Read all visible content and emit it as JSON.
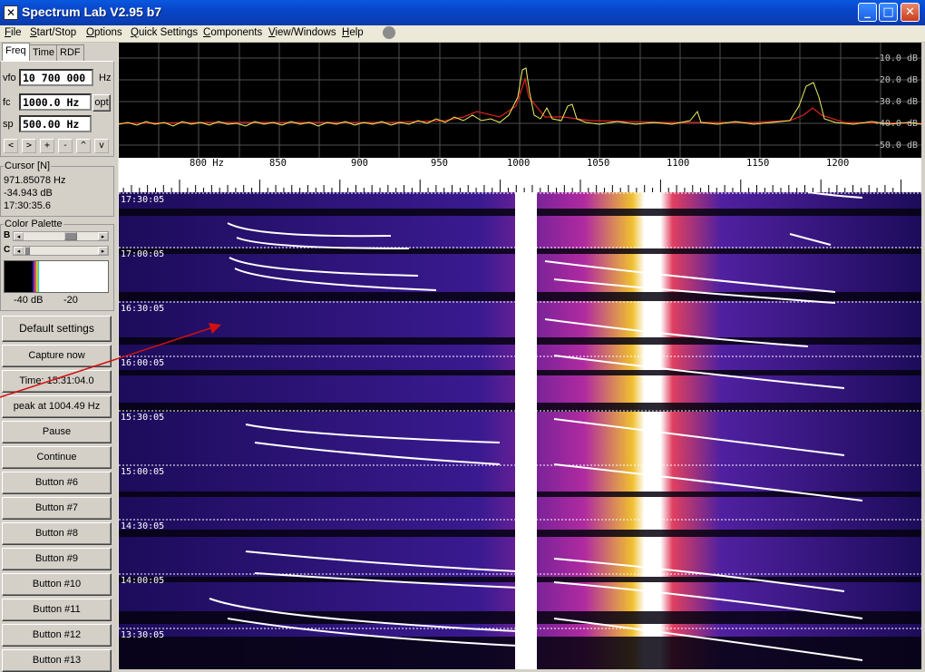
{
  "window": {
    "title": "Spectrum Lab V2.95 b7",
    "min_glyph": "_",
    "max_glyph": "□",
    "close_glyph": "✕"
  },
  "menu": [
    "File",
    "Start/Stop",
    "Options",
    "Quick Settings",
    "Components",
    "View/Windows",
    "Help"
  ],
  "tabs": [
    "Freq",
    "Time",
    "RDF"
  ],
  "freq_panel": {
    "vfo_label": "vfo",
    "vfo_value": "10 700 000",
    "vfo_unit": "Hz",
    "fc_label": "fc",
    "fc_value": "1000.0 Hz",
    "opt_label": "opt",
    "sp_label": "sp",
    "sp_value": "500.00 Hz",
    "nav_buttons": [
      "<",
      ">",
      "+",
      "-",
      "^",
      "v"
    ]
  },
  "cursor": {
    "title": "Cursor [N]",
    "freq": "971.85078 Hz",
    "level": "-34.943 dB",
    "time": "17:30:35.6"
  },
  "color_palette": {
    "title": "Color Palette",
    "b_label": "B",
    "c_label": "C",
    "min_label": "-40 dB",
    "max_label": "-20"
  },
  "side_buttons": [
    "Default settings",
    "Capture now",
    "Time: 15:31:04.0",
    "peak at 1004.49 Hz",
    "Pause",
    "Continue",
    "Button #6",
    "Button #7",
    "Button #8",
    "Button #9",
    "Button #10",
    "Button #11",
    "Button #12",
    "Button #13"
  ],
  "spectrum": {
    "db_labels": [
      "-10.0 dB",
      "-20.0 dB",
      "-30.0 dB",
      "-40.0 dB",
      "-50.0 dB"
    ]
  },
  "freq_axis": {
    "labels": [
      "800 Hz",
      "850",
      "900",
      "950",
      "1000",
      "1050",
      "1100",
      "1150",
      "1200"
    ]
  },
  "waterfall": {
    "time_labels": [
      "17:30:05",
      "17:00:05",
      "16:30:05",
      "16:00:05",
      "15:30:05",
      "15:00:05",
      "14:30:05",
      "14:00:05",
      "13:30:05"
    ]
  },
  "colors": {
    "title_bar": "#0a58e0",
    "spectrum_bg": "#000000",
    "trace_yellow": "#f0f060",
    "trace_red": "#e02020",
    "annotation_arrow": "#d01010"
  }
}
